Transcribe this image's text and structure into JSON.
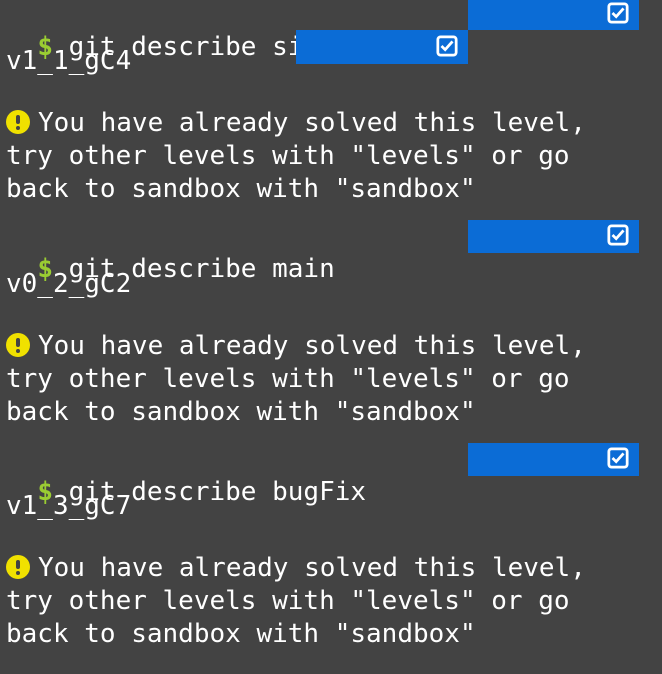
{
  "terminal": {
    "prompt_symbol": "$",
    "entries": [
      {
        "command": "git describe side",
        "output": "v1_1_gC4",
        "message_lines": [
          "You have already solved this level,",
          "try other levels with \"levels\" or go",
          "back to sandbox with \"sandbox\""
        ]
      },
      {
        "command": "git describe main",
        "output": "v0_2_gC2",
        "message_lines": [
          "You have already solved this level,",
          "try other levels with \"levels\" or go",
          "back to sandbox with \"sandbox\""
        ]
      },
      {
        "command": "git describe bugFix",
        "output": "v1_3_gC7",
        "message_lines": [
          "You have already solved this level,",
          "try other levels with \"levels\" or go",
          "back to sandbox with \"sandbox\""
        ]
      }
    ]
  },
  "colors": {
    "background": "#434343",
    "prompt": "#9acd32",
    "status_bar": "#0b6cd6",
    "warning": "#f0e100",
    "text": "#ffffff"
  },
  "icons": {
    "status": "checkbox-checked-icon",
    "warning": "exclamation-circle-icon"
  }
}
